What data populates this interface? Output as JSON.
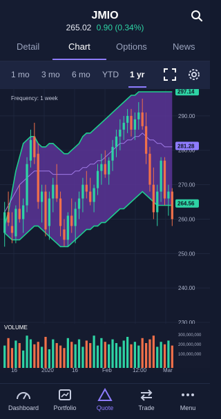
{
  "header": {
    "symbol": "JMIO",
    "price": "265.02",
    "change": "0.90 (0.34%)"
  },
  "tabs": [
    "Detail",
    "Chart",
    "Options",
    "News"
  ],
  "ranges": [
    "1 mo",
    "3 mo",
    "6 mo",
    "YTD",
    "1 yr"
  ],
  "chart_data": {
    "type": "candlestick",
    "frequency_label": "Frequency: 1 week",
    "y_ticks": [
      290.0,
      280.0,
      270.0,
      260.0,
      250.0,
      240.0,
      230.0
    ],
    "ylim": [
      230,
      297
    ],
    "x_ticks": [
      "16",
      "2020",
      "16",
      "Feb",
      "12:00",
      "Mar"
    ],
    "price_labels": [
      {
        "value": 297.14,
        "color": "#2ed3a4"
      },
      {
        "value": 281.28,
        "color": "#8e7cff"
      },
      {
        "value": 264.56,
        "color": "#2ed3a4"
      }
    ],
    "candles": [
      {
        "o": 256,
        "h": 265,
        "l": 252,
        "c": 262
      },
      {
        "o": 262,
        "h": 268,
        "l": 258,
        "c": 259
      },
      {
        "o": 258,
        "h": 262,
        "l": 253,
        "c": 256
      },
      {
        "o": 255,
        "h": 264,
        "l": 253,
        "c": 263
      },
      {
        "o": 263,
        "h": 270,
        "l": 259,
        "c": 260
      },
      {
        "o": 260,
        "h": 266,
        "l": 256,
        "c": 264
      },
      {
        "o": 264,
        "h": 278,
        "l": 262,
        "c": 276
      },
      {
        "o": 277,
        "h": 286,
        "l": 275,
        "c": 283
      },
      {
        "o": 284,
        "h": 288,
        "l": 276,
        "c": 278
      },
      {
        "o": 279,
        "h": 282,
        "l": 263,
        "c": 265
      },
      {
        "o": 265,
        "h": 270,
        "l": 259,
        "c": 268
      },
      {
        "o": 268,
        "h": 270,
        "l": 255,
        "c": 257
      },
      {
        "o": 258,
        "h": 268,
        "l": 254,
        "c": 266
      },
      {
        "o": 266,
        "h": 272,
        "l": 262,
        "c": 270
      },
      {
        "o": 270,
        "h": 276,
        "l": 265,
        "c": 266
      },
      {
        "o": 266,
        "h": 268,
        "l": 255,
        "c": 258
      },
      {
        "o": 257,
        "h": 260,
        "l": 252,
        "c": 254
      },
      {
        "o": 254,
        "h": 262,
        "l": 252,
        "c": 261
      },
      {
        "o": 261,
        "h": 266,
        "l": 256,
        "c": 258
      },
      {
        "o": 258,
        "h": 265,
        "l": 253,
        "c": 263
      },
      {
        "o": 263,
        "h": 268,
        "l": 260,
        "c": 266
      },
      {
        "o": 266,
        "h": 272,
        "l": 262,
        "c": 270
      },
      {
        "o": 270,
        "h": 274,
        "l": 266,
        "c": 268
      },
      {
        "o": 268,
        "h": 272,
        "l": 264,
        "c": 265
      },
      {
        "o": 265,
        "h": 270,
        "l": 262,
        "c": 269
      },
      {
        "o": 269,
        "h": 276,
        "l": 267,
        "c": 274
      },
      {
        "o": 274,
        "h": 279,
        "l": 270,
        "c": 276
      },
      {
        "o": 276,
        "h": 280,
        "l": 272,
        "c": 273
      },
      {
        "o": 273,
        "h": 278,
        "l": 270,
        "c": 277
      },
      {
        "o": 277,
        "h": 283,
        "l": 274,
        "c": 281
      },
      {
        "o": 281,
        "h": 286,
        "l": 278,
        "c": 284
      },
      {
        "o": 284,
        "h": 289,
        "l": 280,
        "c": 286
      },
      {
        "o": 286,
        "h": 290,
        "l": 283,
        "c": 288
      },
      {
        "o": 288,
        "h": 292,
        "l": 285,
        "c": 290
      },
      {
        "o": 290,
        "h": 292,
        "l": 284,
        "c": 286
      },
      {
        "o": 286,
        "h": 291,
        "l": 283,
        "c": 289
      },
      {
        "o": 289,
        "h": 294,
        "l": 286,
        "c": 291
      },
      {
        "o": 291,
        "h": 295,
        "l": 286,
        "c": 287
      },
      {
        "o": 287,
        "h": 291,
        "l": 276,
        "c": 279
      },
      {
        "o": 279,
        "h": 281,
        "l": 268,
        "c": 270
      },
      {
        "o": 270,
        "h": 275,
        "l": 260,
        "c": 262
      },
      {
        "o": 262,
        "h": 270,
        "l": 258,
        "c": 268
      },
      {
        "o": 268,
        "h": 278,
        "l": 265,
        "c": 277
      },
      {
        "o": 277,
        "h": 278,
        "l": 264,
        "c": 266
      },
      {
        "o": 266,
        "h": 270,
        "l": 261,
        "c": 268
      },
      {
        "o": 268,
        "h": 269,
        "l": 258,
        "c": 260
      }
    ],
    "upper_band": [
      258,
      262,
      268,
      274,
      278,
      282,
      283,
      284,
      284,
      282,
      281,
      281,
      282,
      282,
      281,
      280,
      279,
      279,
      280,
      281,
      282,
      284,
      285,
      285,
      286,
      287,
      288,
      289,
      290,
      291,
      292,
      293,
      294,
      295,
      296,
      296,
      297,
      297,
      297,
      297,
      297,
      297,
      297,
      297,
      297,
      297
    ],
    "middle_band": [
      262,
      264,
      266,
      268,
      270,
      271,
      272,
      273,
      274,
      274,
      274,
      274,
      274,
      273,
      273,
      273,
      273,
      273,
      273,
      274,
      274,
      275,
      275,
      276,
      276,
      277,
      277,
      278,
      279,
      280,
      281,
      282,
      282,
      283,
      283,
      284,
      284,
      285,
      284,
      283,
      283,
      282,
      282,
      281,
      281,
      281
    ],
    "lower_band": [
      256,
      255,
      254,
      254,
      254,
      255,
      256,
      257,
      258,
      258,
      257,
      256,
      255,
      254,
      253,
      252,
      252,
      252,
      253,
      254,
      255,
      256,
      257,
      257,
      258,
      258,
      259,
      259,
      260,
      261,
      262,
      263,
      263,
      264,
      265,
      266,
      267,
      268,
      267,
      266,
      265,
      264,
      264,
      264,
      264,
      264
    ],
    "volume_label": "VOLUME",
    "volume_ticks": [
      "300,000,000",
      "200,000,000",
      "100,000,000"
    ],
    "volumes": [
      180,
      240,
      160,
      220,
      200,
      140,
      260,
      230,
      190,
      210,
      170,
      250,
      150,
      230,
      200,
      180,
      160,
      240,
      210,
      190,
      230,
      170,
      220,
      200,
      260,
      180,
      240,
      210,
      190,
      230,
      200,
      170,
      220,
      250,
      190,
      210,
      180,
      240,
      200,
      230,
      260,
      170,
      210,
      190,
      220,
      180
    ]
  },
  "nav": [
    {
      "label": "Dashboard",
      "icon": "speedometer-icon"
    },
    {
      "label": "Portfolio",
      "icon": "portfolio-icon"
    },
    {
      "label": "Quote",
      "icon": "quote-triangle-icon"
    },
    {
      "label": "Trade",
      "icon": "trade-arrows-icon"
    },
    {
      "label": "Menu",
      "icon": "menu-dots-icon"
    }
  ],
  "colors": {
    "up": "#2ed3a4",
    "down": "#f0704a",
    "band": "#6a3fb0",
    "accent": "#8e7cff",
    "band_line": "#1ecf8e",
    "mid_line": "#a07ae8"
  }
}
